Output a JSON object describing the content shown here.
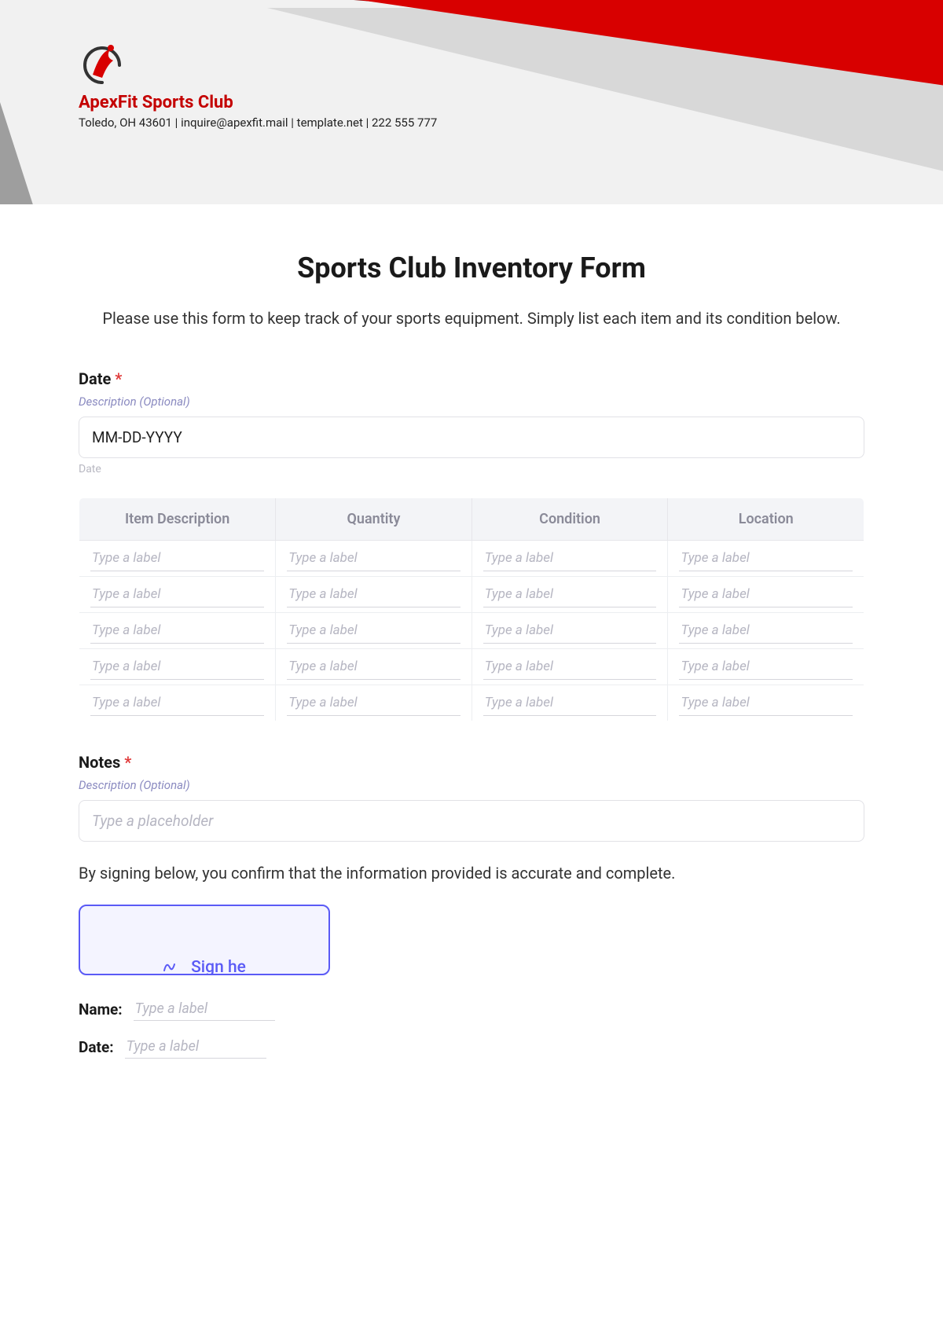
{
  "brand": {
    "name": "ApexFit Sports Club",
    "contact": "Toledo, OH 43601 | inquire@apexfit.mail | template.net | 222 555 777"
  },
  "form": {
    "title": "Sports Club Inventory Form",
    "intro": "Please use this form to keep track of your sports equipment. Simply list each item and its condition below.",
    "date_label": "Date",
    "required_mark": "*",
    "desc_placeholder": "Description (Optional)",
    "date_placeholder": "MM-DD-YYYY",
    "date_helper": "Date",
    "notes_label": "Notes",
    "notes_placeholder": "Type a placeholder",
    "confirm_text": "By signing below, you confirm that the information provided is accurate and complete.",
    "sign_label": "Sign he",
    "name_label": "Name:",
    "sig_date_label": "Date:",
    "label_placeholder": "Type a label"
  },
  "table": {
    "headers": [
      "Item Description",
      "Quantity",
      "Condition",
      "Location"
    ],
    "rows": 5,
    "cell_placeholder": "Type a label"
  }
}
